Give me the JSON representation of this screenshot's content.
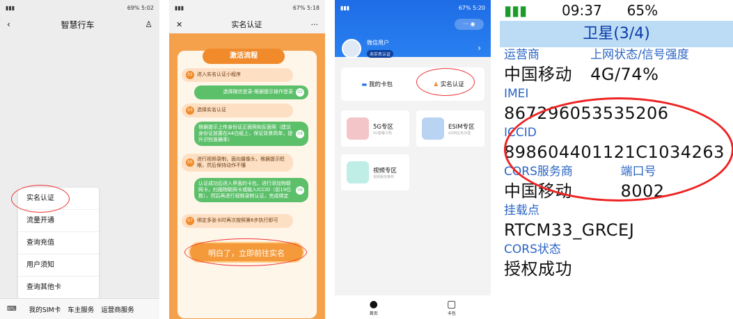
{
  "p1": {
    "time": "5:02",
    "battery": "69%",
    "title": "智慧行车",
    "menu": [
      "实名认证",
      "流量开通",
      "查询充值",
      "用户须知",
      "查询其他卡"
    ],
    "bottom": [
      "我的SIM卡",
      "车主服务",
      "运营商服务"
    ]
  },
  "p2": {
    "time": "5:18",
    "battery": "67%",
    "title": "实名认证",
    "banner": "激活流程",
    "steps": [
      {
        "n": "01",
        "t": "进入实名认证小程序"
      },
      {
        "n": "02",
        "t": "选择微信登录-根据提示操作登录"
      },
      {
        "n": "03",
        "t": "选择实名认证"
      },
      {
        "n": "04",
        "t": "根据提示上传身份证正面照和反面照（建议身份证放置在A4白纸上，保证背景简单，提升识别准确率）"
      },
      {
        "n": "05",
        "t": "进行视频录制，面向摄像头，根据提示眨眼，然后保持动作不懂"
      },
      {
        "n": "06",
        "t": "认证成功后进入界面的卡包，进行添加物联网卡，扫描物联网卡或输入ICCID（前19位数），然后再进行视频录制认证，完成绑定"
      },
      {
        "n": "07",
        "t": "绑定多张卡时再次按照第6步执行即可"
      }
    ],
    "cta": "明白了，立即前往实名"
  },
  "p3": {
    "time": "5:20",
    "battery": "67%",
    "user": "微信用户",
    "badge": "未实名认证",
    "tab1": "我的卡包",
    "tab2": "实名认证",
    "tiles": [
      {
        "name": "5G专区",
        "sub": "5G套餐订购"
      },
      {
        "name": "ESIM专区",
        "sub": "eSIM业务办理"
      },
      {
        "name": "视频专区",
        "sub": "视频服务推荐"
      }
    ],
    "nav": [
      "首页",
      "卡包"
    ]
  },
  "p4": {
    "time": "09:37",
    "battery": "65%",
    "title": "卫星(3/4)",
    "op_label": "运营商",
    "status_label": "上网状态/信号强度",
    "op": "中国移动",
    "status": "4G/74%",
    "imei_label": "IMEI",
    "imei": "867296053535206",
    "iccid_label": "ICCID",
    "iccid": "898604401121C1034263",
    "cors_label": "CORS服务商",
    "port_label": "端口号",
    "cors": "中国移动",
    "port": "8002",
    "mount_label": "挂载点",
    "mount": "RTCM33_GRCEJ",
    "corsst_label": "CORS状态",
    "corsst": "授权成功"
  }
}
